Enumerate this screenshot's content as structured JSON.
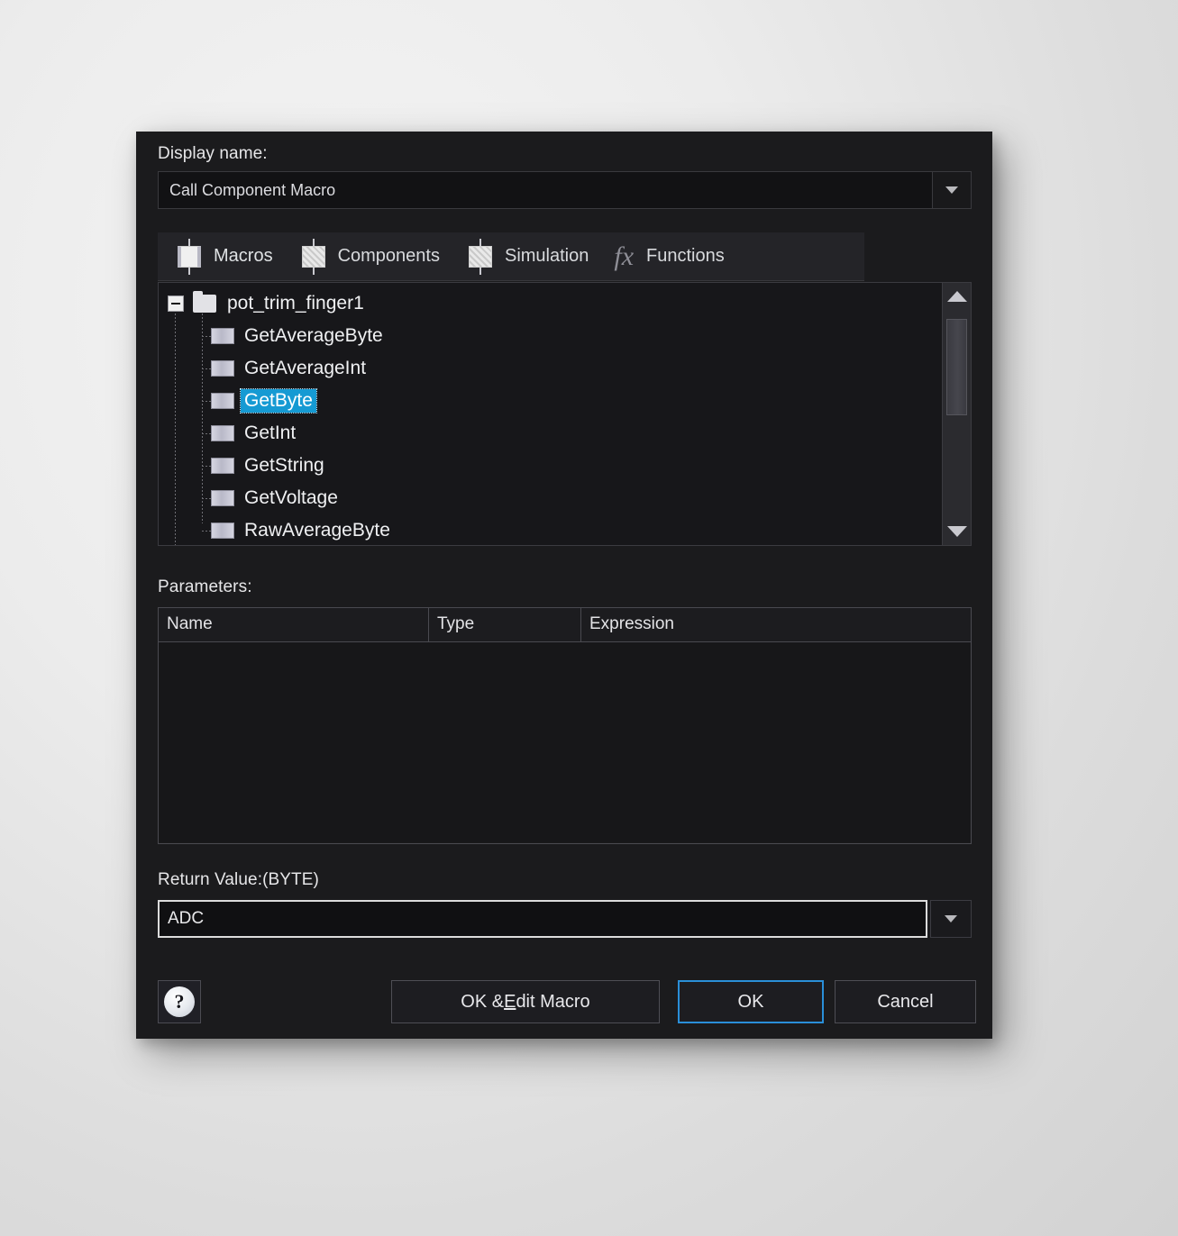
{
  "dialog": {
    "display_name": {
      "label": "Display name:",
      "value": "Call Component Macro",
      "arrow_icon": "chevron-down-icon"
    },
    "tabs": [
      {
        "label": "Macros",
        "icon": "component-block-icon",
        "selected": true
      },
      {
        "label": "Components",
        "icon": "component-block-hatched-icon",
        "selected": false
      },
      {
        "label": "Simulation",
        "icon": "component-block-hatched-icon",
        "selected": false
      },
      {
        "label": "Functions",
        "icon": "fx-icon",
        "glyph": "fx",
        "selected": false
      }
    ],
    "tree": {
      "root": {
        "label": "pot_trim_finger1",
        "icon": "folder-icon",
        "expander": "minus-expander-icon"
      },
      "items": [
        {
          "label": "GetAverageByte",
          "icon": "macro-block-icon",
          "selected": false
        },
        {
          "label": "GetAverageInt",
          "icon": "macro-block-icon",
          "selected": false
        },
        {
          "label": "GetByte",
          "icon": "macro-block-icon",
          "selected": true
        },
        {
          "label": "GetInt",
          "icon": "macro-block-icon",
          "selected": false
        },
        {
          "label": "GetString",
          "icon": "macro-block-icon",
          "selected": false
        },
        {
          "label": "GetVoltage",
          "icon": "macro-block-icon",
          "selected": false
        },
        {
          "label": "RawAverageByte",
          "icon": "macro-block-icon",
          "selected": false
        }
      ],
      "scrollbar": {
        "up_icon": "scroll-up-arrow-icon",
        "down_icon": "scroll-down-arrow-icon"
      },
      "selection_color": "#159ad3"
    },
    "parameters": {
      "label": "Parameters:",
      "columns": [
        "Name",
        "Type",
        "Expression"
      ],
      "rows": []
    },
    "return_value": {
      "label": "Return Value:(BYTE)",
      "value": "ADC",
      "arrow_icon": "chevron-down-icon"
    },
    "footer": {
      "help_label": "?",
      "ok_edit_macro_pre": "OK & ",
      "ok_edit_macro_accel": "E",
      "ok_edit_macro_post": "dit Macro",
      "ok_label": "OK",
      "cancel_label": "Cancel",
      "focus_color": "#2a8fd8"
    }
  }
}
